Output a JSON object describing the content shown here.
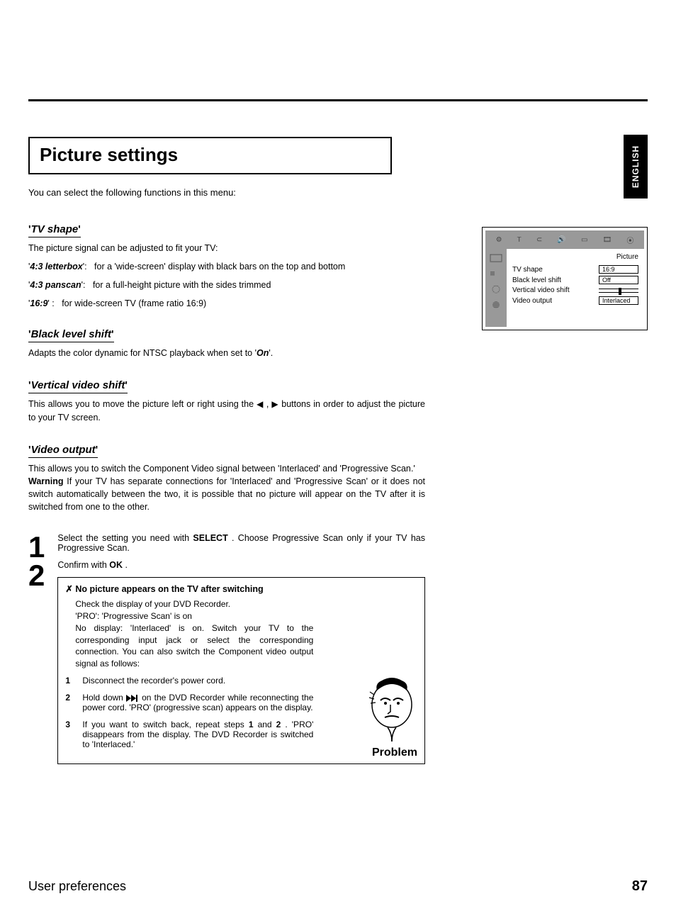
{
  "language_tab": "ENGLISH",
  "title": "Picture settings",
  "intro": "You can select the following functions in this menu:",
  "sections": {
    "tv_shape": {
      "heading": "TV shape",
      "text": "The picture signal can be adjusted to fit your TV:",
      "items": [
        {
          "term": "4:3 letterbox",
          "def": "for a 'wide-screen' display with black bars on the top and bottom"
        },
        {
          "term": "4:3 panscan",
          "def": "for a full-height picture with the sides trimmed"
        },
        {
          "term": "16:9",
          "def": "for wide-screen TV (frame ratio 16:9)"
        }
      ]
    },
    "black_level": {
      "heading": "Black level shift",
      "text_pre": "Adapts the color dynamic for NTSC playback when set to '",
      "text_em": "On",
      "text_post": "'."
    },
    "vertical": {
      "heading": "Vertical video shift",
      "text_pre": "This allows you to move the picture left or right using the ",
      "text_post": " buttons in order to adjust the picture to your TV screen."
    },
    "video_output": {
      "heading": "Video output",
      "p1": "This allows you to switch the Component Video signal between 'Interlaced' and 'Progressive Scan.'",
      "warn_label": "Warning",
      "warn_text": " If your TV has separate connections for 'Interlaced' and 'Progressive Scan' or it does not switch automatically between the two, it is possible that no picture will appear on the TV after it is switched from one to the other."
    }
  },
  "steps": {
    "n1": "1",
    "n2": "2",
    "s1_pre": "Select the setting you need with ",
    "s1_btn": "SELECT",
    "s1_post": " . Choose Progressive Scan only if your TV has Progressive Scan.",
    "s2_pre": "Confirm with ",
    "s2_btn": "OK",
    "s2_post": " ."
  },
  "problem": {
    "title": "No picture appears on the TV after switching",
    "body": "Check the display of your DVD Recorder.\n'PRO': 'Progressive Scan' is on\nNo display: 'Interlaced' is on. Switch your TV to the corresponding input jack or select the corresponding connection. You can also switch the Component video output signal as follows:",
    "items": [
      {
        "n": "1",
        "t": "Disconnect the recorder's power cord."
      },
      {
        "n": "2",
        "t_pre": "Hold down ",
        "t_post": " on the DVD Recorder while reconnecting the power cord. 'PRO' (progressive scan) appears on the display."
      },
      {
        "n": "3",
        "t_pre": "If you want to switch back, repeat steps ",
        "b1": "1",
        "mid": " and ",
        "b2": "2",
        "t_post": " . 'PRO' disappears from the display. The DVD Recorder is switched to 'Interlaced.'"
      }
    ],
    "label": "Problem"
  },
  "osd": {
    "heading": "Picture",
    "rows": [
      {
        "label": "TV shape",
        "value": "16:9"
      },
      {
        "label": "Black level shift",
        "value": "Off"
      },
      {
        "label": "Vertical video shift",
        "slider": true
      },
      {
        "label": "Video output",
        "value": "Interlaced"
      }
    ]
  },
  "footer": {
    "title": "User preferences",
    "page": "87"
  }
}
